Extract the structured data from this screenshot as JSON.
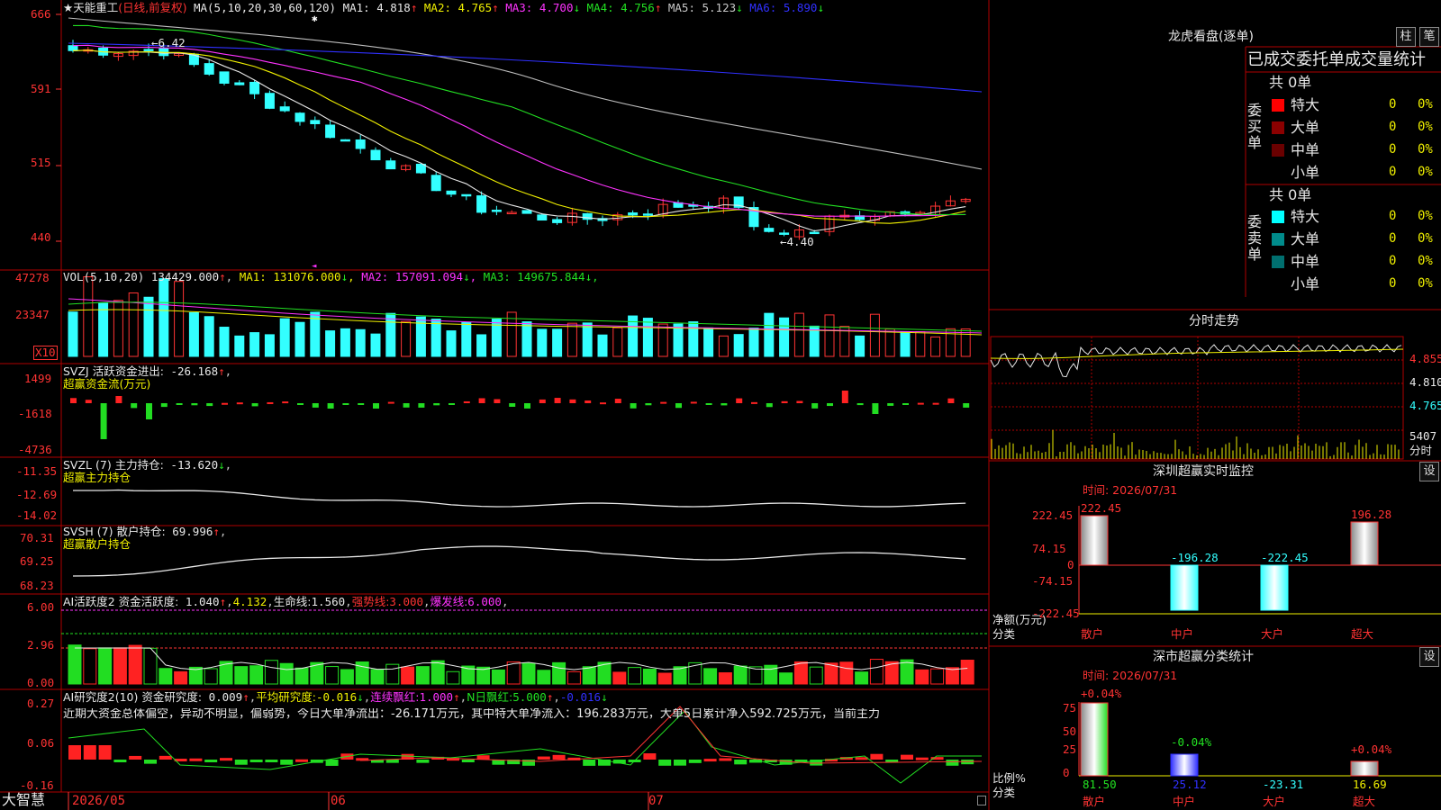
{
  "header": {
    "title": "★天能重工",
    "mode": "(日线,前复权)",
    "ma_label": "MA(5,10,20,30,60,120)",
    "ma": [
      {
        "label": "MA1:",
        "value": "4.818",
        "arrow": "↑",
        "color": "#e8e8e8"
      },
      {
        "label": "MA2:",
        "value": "4.765",
        "arrow": "↑",
        "color": "#f0f000"
      },
      {
        "label": "MA3:",
        "value": "4.700",
        "arrow": "↓",
        "color": "#ff33ff"
      },
      {
        "label": "MA4:",
        "value": "4.756",
        "arrow": "↑",
        "color": "#22e022"
      },
      {
        "label": "MA5:",
        "value": "5.123",
        "arrow": "↓",
        "color": "#c8c8c8"
      },
      {
        "label": "MA6:",
        "value": "5.890",
        "arrow": "↓",
        "color": "#3030ff"
      }
    ]
  },
  "price_axis": [
    "666",
    "591",
    "515",
    "440"
  ],
  "price_marks": {
    "high": "6.42",
    "low": "4.40"
  },
  "vol": {
    "label": "VOL(5,10,20)",
    "value": "134429.000",
    "arrow": "↑",
    "ma": [
      {
        "label": "MA1:",
        "value": "131076.000",
        "arrow": "↓",
        "color": "#f0f000"
      },
      {
        "label": "MA2:",
        "value": "157091.094",
        "arrow": "↓",
        "color": "#ff33ff"
      },
      {
        "label": "MA3:",
        "value": "149675.844",
        "arrow": "↓",
        "color": "#22e022"
      }
    ],
    "axis": [
      "47278",
      "23347"
    ],
    "unit": "X10"
  },
  "svzj": {
    "label": "SVZJ  活跃资金进出:",
    "value": "-26.168",
    "arrow": "↑",
    "sub": "超赢资金流(万元)",
    "axis": [
      "1499",
      "-1618",
      "-4736"
    ]
  },
  "svzl": {
    "label": "SVZL (7) 主力持仓:",
    "value": "-13.620",
    "arrow": "↓",
    "sub": "超赢主力持仓",
    "axis": [
      "-11.35",
      "-12.69",
      "-14.02"
    ]
  },
  "svsh": {
    "label": "SVSH (7) 散户持仓:",
    "value": "69.996",
    "arrow": "↑",
    "sub": "超赢散户持仓",
    "axis": [
      "70.31",
      "69.25",
      "68.23"
    ]
  },
  "ai1": {
    "label": "AI活跃度2 资金活跃度:",
    "value": "1.040",
    "arrow": "↑",
    "v2": "4.132",
    "l3": "生命线:",
    "v3": "1.560",
    "l4": "强势线:",
    "v4": "3.000",
    "l5": "爆发线:",
    "v5": "6.000",
    "axis": [
      "6.00",
      "2.96",
      "0.00"
    ]
  },
  "ai2": {
    "label": "AI研究度2(10) 资金研究度:",
    "value": "0.009",
    "arrow": "↑",
    "l2": "平均研究度:",
    "v2": "-0.016",
    "l3": "连续飘红:",
    "v3": "1.000",
    "l4": "N日飘红:",
    "v4": "5.000",
    "v5": "-0.016",
    "axis": [
      "0.27",
      "0.06",
      "-0.16"
    ],
    "comment": "近期大资金总体偏空，异动不明显，偏弱势，今日大单净流出：-26.171万元，其中特大单净流入：196.283万元，大单5日累计净入592.725万元，当前主力"
  },
  "bottom": {
    "brand": "大智慧",
    "dates": [
      "2026/05",
      "06",
      "07"
    ]
  },
  "lhb": {
    "title": "龙虎看盘(逐单)",
    "btn1": "柱",
    "btn2": "笔",
    "subtitle": "已成交委托单成交量统计",
    "buy": {
      "side": "委买单",
      "total": "共 0单",
      "rows": [
        {
          "name": "特大",
          "v": "0",
          "p": "0%",
          "color": "#ff0000"
        },
        {
          "name": "大单",
          "v": "0",
          "p": "0%",
          "color": "#8b0000"
        },
        {
          "name": "中单",
          "v": "0",
          "p": "0%",
          "color": "#6a0000"
        },
        {
          "name": "小单",
          "v": "0",
          "p": "0%",
          "color": "#000000"
        }
      ]
    },
    "sell": {
      "side": "委卖单",
      "total": "共 0单",
      "rows": [
        {
          "name": "特大",
          "v": "0",
          "p": "0%",
          "color": "#00ffff"
        },
        {
          "name": "大单",
          "v": "0",
          "p": "0%",
          "color": "#008b8b"
        },
        {
          "name": "中单",
          "v": "0",
          "p": "0%",
          "color": "#006f6f"
        },
        {
          "name": "小单",
          "v": "0",
          "p": "0%",
          "color": "#000000"
        }
      ]
    }
  },
  "fenshi": {
    "title": "分时走势",
    "axis": [
      "4.855",
      "4.810",
      "4.765"
    ],
    "vol": "5407",
    "unit": "分时"
  },
  "sz_monitor": {
    "title": "深圳超赢实时监控",
    "btn": "设",
    "time": "时间: 2026/07/31",
    "axis": [
      "222.45",
      "74.15",
      "0",
      "-74.15",
      "-222.45"
    ],
    "bars": [
      {
        "label": "散户",
        "value": "222.45"
      },
      {
        "label": "中户",
        "value": "-196.28"
      },
      {
        "label": "大户",
        "value": "-222.45"
      },
      {
        "label": "超大",
        "value": "196.28"
      }
    ],
    "ylabel": "净额(万元)",
    "xlabel": "分类"
  },
  "sz_class": {
    "title": "深市超赢分类统计",
    "btn": "设",
    "time": "时间: 2026/07/31",
    "axis": [
      "75",
      "50",
      "25",
      "0"
    ],
    "bars": [
      {
        "label": "散户",
        "pct": "+0.04%",
        "value": "81.50"
      },
      {
        "label": "中户",
        "pct": "-0.04%",
        "value": "25.12"
      },
      {
        "label": "大户",
        "pct": "",
        "value": "-23.31"
      },
      {
        "label": "超大",
        "pct": "+0.04%",
        "value": "16.69"
      }
    ],
    "ylabel": "比例%",
    "xlabel": "分类"
  }
}
